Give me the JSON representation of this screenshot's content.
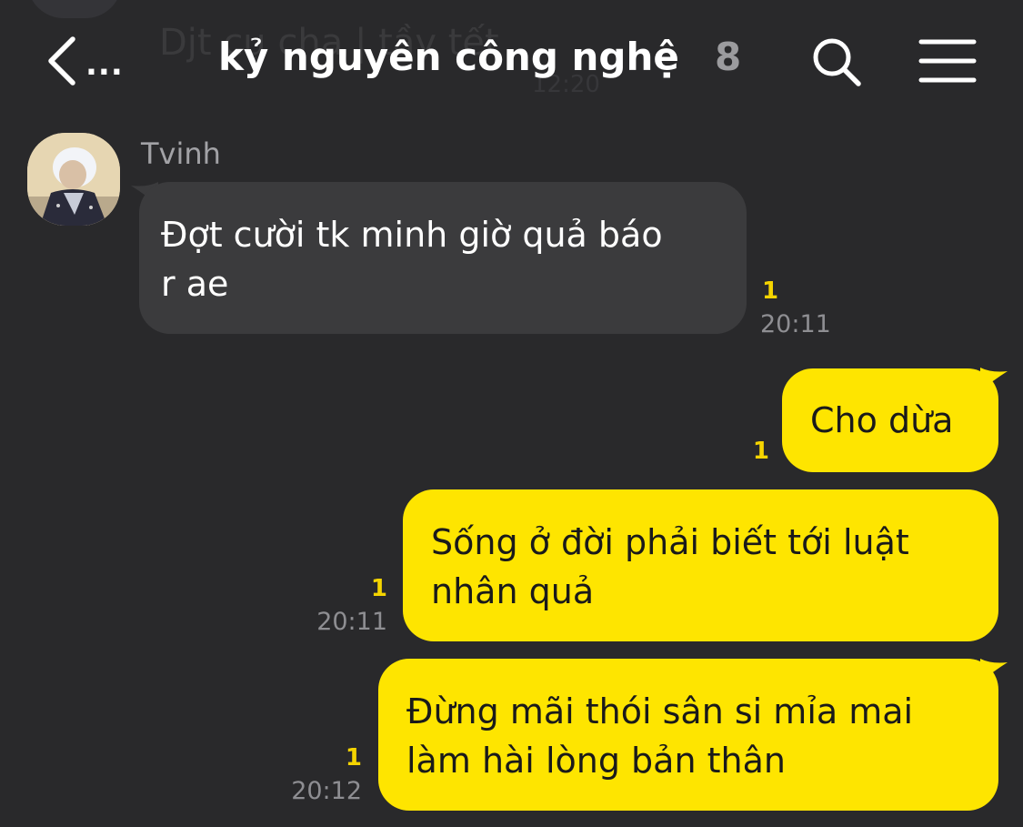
{
  "header": {
    "back_ellipsis": "...",
    "title": "kỷ nguyên công nghệ",
    "member_count": "8",
    "ghost_title": "Djt cụ cha | tầy tết",
    "ghost_time": "12:20"
  },
  "messages": [
    {
      "direction": "in",
      "sender": "Tvinh",
      "lines": [
        "Đợt cười tk minh giờ quả báo",
        "r ae"
      ],
      "unread": "1",
      "time": "20:11"
    },
    {
      "direction": "out",
      "lines": [
        "Cho dừa"
      ],
      "unread": "1",
      "time": ""
    },
    {
      "direction": "out",
      "lines": [
        "Sống ở đời phải biết tới luật",
        "nhân quả"
      ],
      "unread": "1",
      "time": "20:11"
    },
    {
      "direction": "out",
      "lines": [
        "Đừng mãi thói sân si mỉa mai",
        "làm hài lòng bản thân"
      ],
      "unread": "1",
      "time": "20:12"
    }
  ],
  "colors": {
    "background": "#29292b",
    "incoming_bubble": "#3b3b3d",
    "outgoing_bubble": "#fee500",
    "unread_accent": "#f5d400"
  },
  "icons": [
    "chevron-left-icon",
    "search-icon",
    "menu-icon",
    "avatar"
  ]
}
